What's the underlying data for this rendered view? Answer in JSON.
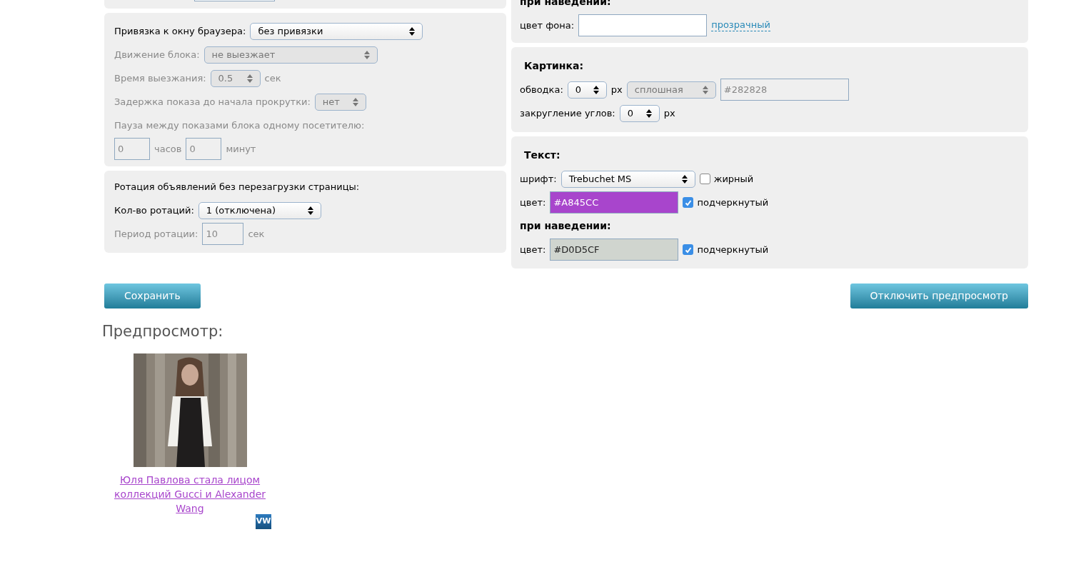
{
  "left_panels": [
    {
      "lines": [
        {
          "controls": [
            {
              "kind": "label",
              "text": "Привязка к окну браузера:",
              "disabled": false
            },
            {
              "kind": "select",
              "value": "без привязки",
              "disabled": false
            }
          ]
        },
        {
          "controls": [
            {
              "kind": "label",
              "text": "Движение блока:",
              "disabled": true
            },
            {
              "kind": "select",
              "value": "не выезжает",
              "disabled": true
            }
          ]
        },
        {
          "controls": [
            {
              "kind": "label",
              "text": "Время выезжания:",
              "disabled": true
            },
            {
              "kind": "select",
              "value": "0.5",
              "disabled": true
            },
            {
              "kind": "label",
              "text": "сек",
              "disabled": true
            }
          ]
        },
        {
          "controls": [
            {
              "kind": "label",
              "text": "Задержка показа до начала прокрутки:",
              "disabled": true
            },
            {
              "kind": "select",
              "value": "нет",
              "disabled": true
            }
          ]
        },
        {
          "controls": [
            {
              "kind": "label",
              "text": "Пауза между показами блока одному посетителю:",
              "disabled": true
            }
          ]
        },
        {
          "controls": [
            {
              "kind": "input",
              "value": "0",
              "disabled": true
            },
            {
              "kind": "label",
              "text": "часов",
              "disabled": true
            },
            {
              "kind": "input",
              "value": "0",
              "disabled": true
            },
            {
              "kind": "label",
              "text": "минут",
              "disabled": true
            }
          ]
        }
      ]
    },
    {
      "lines": [
        {
          "controls": [
            {
              "kind": "label",
              "text": "Ротация объявлений без перезагрузки страницы:",
              "disabled": false
            }
          ]
        },
        {
          "controls": [
            {
              "kind": "label",
              "text": "Кол-во ротаций:",
              "disabled": false
            },
            {
              "kind": "select",
              "value": "1 (отключена)",
              "disabled": false
            }
          ]
        },
        {
          "controls": [
            {
              "kind": "label",
              "text": "Период ротации:",
              "disabled": true
            },
            {
              "kind": "input",
              "value": "10",
              "disabled": true
            },
            {
              "kind": "label",
              "text": "сек",
              "disabled": true
            }
          ]
        }
      ]
    }
  ],
  "right_panels": [
    {
      "lines": [
        {
          "controls": [
            {
              "kind": "heading",
              "text": "при наведении:"
            }
          ]
        },
        {
          "controls": [
            {
              "kind": "label",
              "text": "цвет фона:",
              "disabled": false
            },
            {
              "kind": "input",
              "disabled": false
            },
            {
              "kind": "link",
              "text": "прозрачный"
            }
          ]
        }
      ]
    },
    {
      "lines": [
        {
          "controls": [
            {
              "kind": "heading",
              "text": "Картинка:"
            }
          ]
        },
        {
          "controls": [
            {
              "kind": "label",
              "text": "обводка:",
              "disabled": false
            },
            {
              "kind": "select",
              "value": "0",
              "disabled": false
            },
            {
              "kind": "label",
              "text": "px",
              "disabled": false
            },
            {
              "kind": "select",
              "value": "сплошная",
              "disabled": true
            },
            {
              "kind": "input",
              "value": "#282828",
              "disabled": true
            }
          ]
        },
        {
          "controls": [
            {
              "kind": "label",
              "text": "закругление углов:",
              "disabled": false
            },
            {
              "kind": "select",
              "value": "0",
              "disabled": false
            },
            {
              "kind": "label",
              "text": "px",
              "disabled": false
            }
          ]
        }
      ]
    },
    {
      "lines": [
        {
          "controls": [
            {
              "kind": "heading",
              "text": "Текст:"
            }
          ]
        },
        {
          "controls": [
            {
              "kind": "label",
              "text": "шрифт:",
              "disabled": false
            },
            {
              "kind": "select",
              "value": "Trebuchet MS",
              "disabled": false
            },
            {
              "kind": "checkbox",
              "text": "жирный",
              "checked": false
            }
          ]
        },
        {
          "controls": [
            {
              "kind": "label",
              "text": "цвет:",
              "disabled": false
            },
            {
              "kind": "color",
              "value": "#A845CC",
              "color": "#a845cc"
            },
            {
              "kind": "checkbox",
              "text": "подчеркнутый",
              "checked": true
            }
          ]
        },
        {
          "controls": [
            {
              "kind": "heading",
              "text": "при наведении:"
            }
          ]
        },
        {
          "controls": [
            {
              "kind": "label",
              "text": "цвет:",
              "disabled": false
            },
            {
              "kind": "color",
              "value": "#D0D5CF",
              "color": "#d0d5cf"
            },
            {
              "kind": "checkbox",
              "text": "подчеркнутый",
              "checked": true
            }
          ]
        }
      ]
    }
  ],
  "buttons": [
    "Сохранить",
    "Отключить предпросмотр"
  ],
  "preview": {
    "title": "Предпросмотр:",
    "card": {
      "caption": "Юля Павлова стала лицом коллекций Gucci и Alexander Wang",
      "badge": "VW"
    }
  }
}
